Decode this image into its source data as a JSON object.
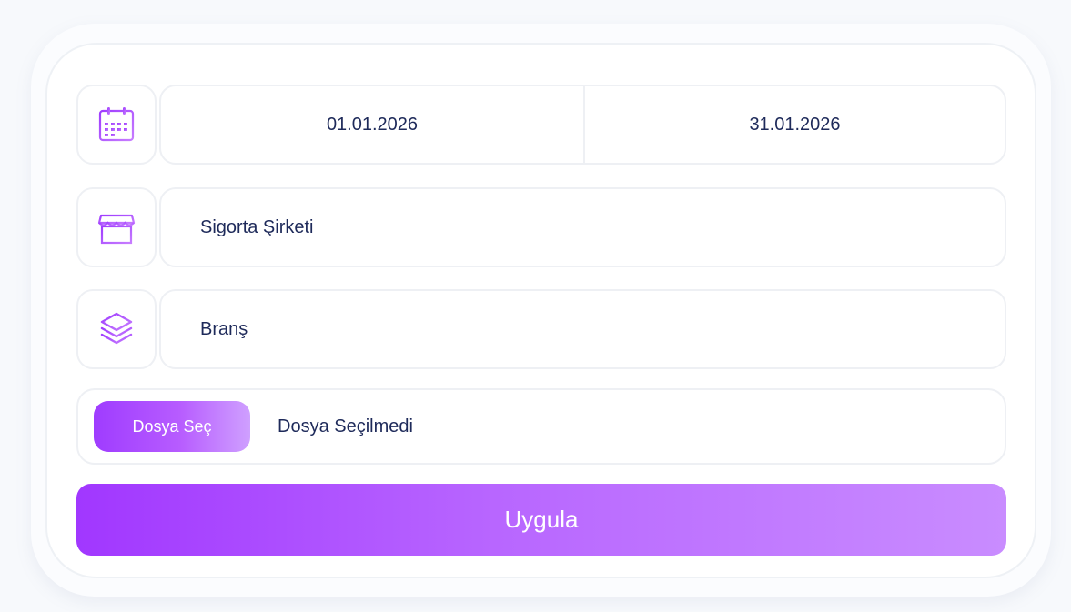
{
  "date_range": {
    "start": "01.01.2026",
    "end": "31.01.2026",
    "icon": "calendar-icon"
  },
  "insurance_company": {
    "label": "Sigorta Şirketi",
    "icon": "store-icon"
  },
  "branch": {
    "label": "Branş",
    "icon": "layers-icon"
  },
  "file": {
    "button_label": "Dosya Seç",
    "status": "Dosya Seçilmedi"
  },
  "apply_button": {
    "label": "Uygula"
  },
  "colors": {
    "accent": "#a137ff",
    "accent_light": "#c98cff",
    "text": "#1e2a5a",
    "border": "#eef0f4"
  }
}
